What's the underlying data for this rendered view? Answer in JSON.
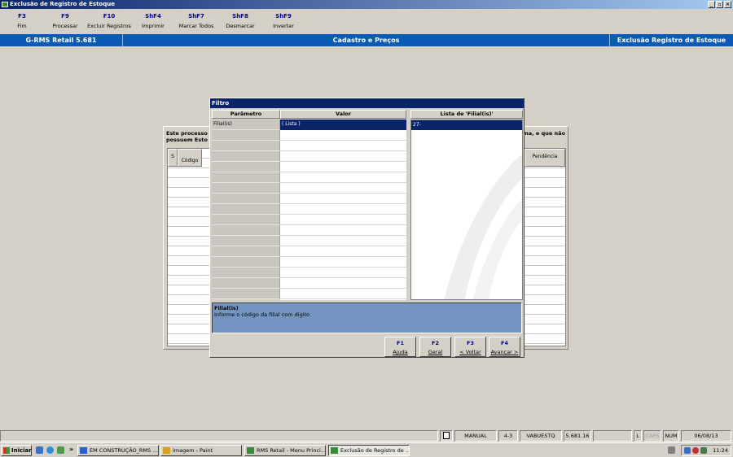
{
  "window": {
    "title": "Exclusão de Registro de Estoque",
    "buttons": [
      "_",
      "▫",
      "×"
    ]
  },
  "function_keys": [
    {
      "key": "F3",
      "label": "Fim"
    },
    {
      "key": "F9",
      "label": "Processar"
    },
    {
      "key": "F10",
      "label": "Excluir Registros"
    },
    {
      "key": "ShF4",
      "label": "Imprimir"
    },
    {
      "key": "ShF7",
      "label": "Marcar Todos"
    },
    {
      "key": "ShF8",
      "label": "Desmarcar"
    },
    {
      "key": "ShF9",
      "label": "Inverter"
    }
  ],
  "infobar": {
    "version": "G-RMS Retail 5.681",
    "module": "Cadastro e Preços",
    "screen": "Exclusão Registro de Estoque"
  },
  "background": {
    "text_line1_left": "Este processo",
    "text_line1_right": "ma, e que não",
    "text_line2_left": "possuem Esto",
    "col_s": "S",
    "col_codigo": "Código",
    "col_pendencia": "Pendência"
  },
  "dialog": {
    "title": "Filtro",
    "col_parametro": "Parâmetro",
    "col_valor": "Valor",
    "col_lista": "Lista de 'Filial(is)'",
    "param_selected": "Filial(is)",
    "value_selected": "( Lista )",
    "list_selected": "27-",
    "help_title": "Filial(is)",
    "help_text": "Informe o código da filial com digito",
    "buttons": [
      {
        "key": "F1",
        "label": "Ajuda"
      },
      {
        "key": "F2",
        "label": "Geral"
      },
      {
        "key": "F3",
        "label": "< Voltar"
      },
      {
        "key": "F4",
        "label": "Avançar >"
      }
    ]
  },
  "statusbar": {
    "mode": "MANUAL",
    "code": "4-3",
    "program": "VABUESTQ",
    "version": "5.681.16",
    "l": "L",
    "caps": "CAPS",
    "num": "NUM",
    "date": "06/08/13"
  },
  "taskbar": {
    "start": "Iniciar",
    "chevron": "»",
    "tasks": [
      "EM CONSTRUÇÃO_RMS ...",
      "imagem - Paint",
      "RMS Retail - Menu Princi...",
      "Exclusão de Registro de ..."
    ],
    "clock": "11:24"
  }
}
